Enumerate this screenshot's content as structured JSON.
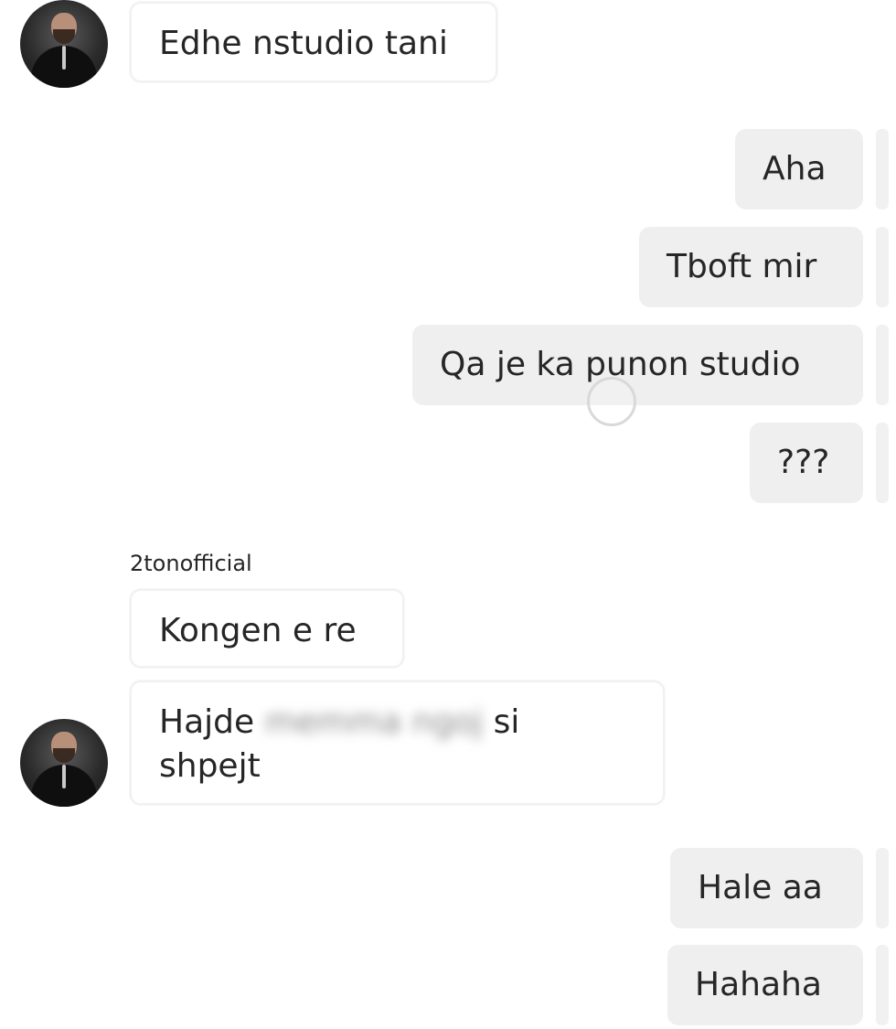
{
  "conversation": {
    "sender_username": "2tonofficial",
    "messages": [
      {
        "direction": "incoming",
        "text": "Edhe nstudio tani"
      },
      {
        "direction": "outgoing",
        "text": "Aha"
      },
      {
        "direction": "outgoing",
        "text": "Tboft mir"
      },
      {
        "direction": "outgoing",
        "text": "Qa je ka punon studio"
      },
      {
        "direction": "outgoing",
        "text": "???"
      },
      {
        "direction": "incoming",
        "text": "Kongen e re"
      },
      {
        "direction": "incoming",
        "text_prefix": "Hajde",
        "text_blurred": "memma ngoj",
        "text_suffix_line1": "si",
        "text_line2": "shpejt"
      },
      {
        "direction": "outgoing",
        "text": "Hale aa"
      },
      {
        "direction": "outgoing",
        "text": "Hahaha"
      }
    ]
  },
  "icons": {
    "avatar": "profile-avatar",
    "cursor": "touch-indicator-icon"
  },
  "colors": {
    "outgoing_bubble": "#efefef",
    "incoming_bubble": "#ffffff",
    "text": "#262626"
  }
}
